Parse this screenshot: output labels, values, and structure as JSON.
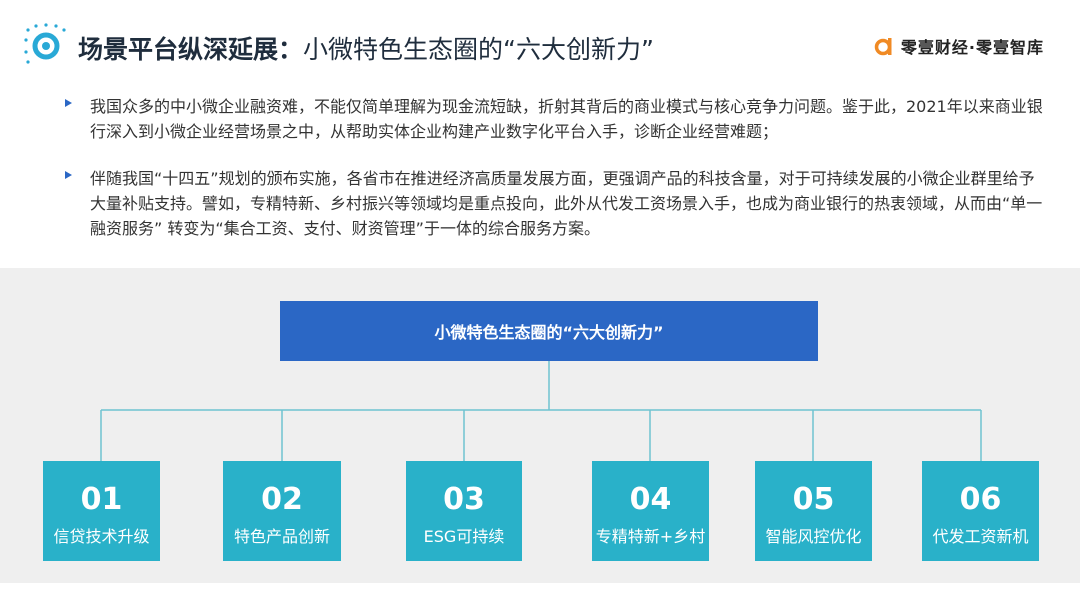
{
  "header": {
    "title_bold": "场景平台纵深延展：",
    "title_rest": "小微特色生态圈的“六大创新力”",
    "brand_text": "零壹财经·零壹智库",
    "icon": "ring-dot-icon",
    "brand_icon": "brand-a-logo"
  },
  "bullets": [
    {
      "text": "我国众多的中小微企业融资难，不能仅简单理解为现金流短缺，折射其背后的商业模式与核心竞争力问题。鉴于此，2021年以来商业银行深入到小微企业经营场景之中，从帮助实体企业构建产业数字化平台入手，诊断企业经营难题；"
    },
    {
      "text": "伴随我国“十四五”规划的颁布实施，各省市在推进经济高质量发展方面，更强调产品的科技含量，对于可持续发展的小微企业群里给予大量补贴支持。譬如，专精特新、乡村振兴等领域均是重点投向，此外从代发工资场景入手，也成为商业银行的热衷领域，从而由“单一融资服务” 转变为“集合工资、支付、财资管理”于一体的综合服务方案。"
    }
  ],
  "diagram": {
    "root": "小微特色生态圈的“六大创新力”",
    "nodes": [
      {
        "num": "01",
        "label": "信贷技术升级"
      },
      {
        "num": "02",
        "label": "特色产品创新"
      },
      {
        "num": "03",
        "label": "ESG可持续"
      },
      {
        "num": "04",
        "label": "专精特新+乡村"
      },
      {
        "num": "05",
        "label": "智能风控优化"
      },
      {
        "num": "06",
        "label": "代发工资新机"
      }
    ]
  },
  "colors": {
    "root_box": "#2b67c5",
    "node_box": "#29b1c9",
    "connector": "#6fc3d1",
    "background_band": "#efefef",
    "bullet_arrow": "#2b67c5",
    "brand_orange": "#f08a24"
  }
}
